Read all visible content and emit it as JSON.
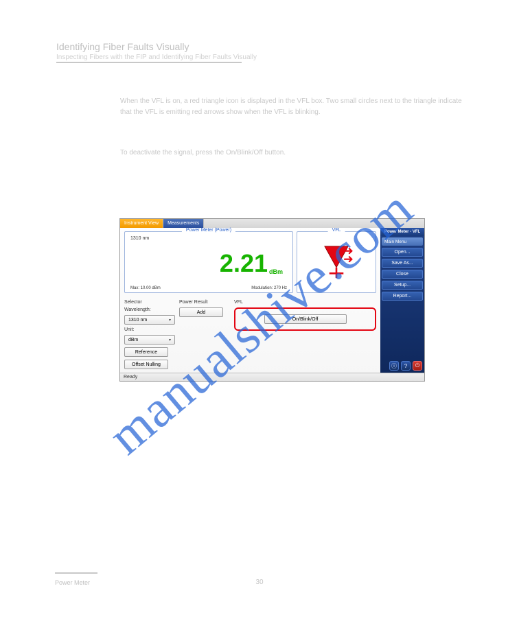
{
  "page": {
    "header_title": "Identifying Fiber Faults Visually",
    "header_subtitle": "Inspecting Fibers with the FIP and Identifying Fiber Faults Visually",
    "para1_line1": "When the VFL is on, a red triangle icon is displayed in the VFL box. Two small",
    "para1_line2": "circles next to the triangle indicate that the VFL is emitting red arrows show",
    "para1_line3": "when the VFL is blinking.",
    "para2": "To deactivate the signal, press the On/Blink/Off button.",
    "footer": "Power Meter",
    "pagenum": "30"
  },
  "app": {
    "tabs": {
      "instrument": "Instrument View",
      "measurements": "Measurements"
    },
    "title_bar": "Power Meter - VFL",
    "power_panel": {
      "title": "Power Meter (Power)",
      "wavelength": "1310 nm",
      "value": "2.21",
      "unit": "dBm",
      "max": "Max: 10.00 dBm",
      "modulation": "Modulation: 270 Hz"
    },
    "vfl_panel": {
      "title": "VFL"
    },
    "selector": {
      "header": "Selector",
      "wavelength_label": "Wavelength:",
      "wavelength_value": "1310 nm",
      "unit_label": "Unit:",
      "unit_value": "dBm",
      "reference_btn": "Reference",
      "offset_btn": "Offset Nulling"
    },
    "power_result": {
      "header": "Power Result",
      "add_btn": "Add"
    },
    "vfl_ctrl": {
      "header": "VFL",
      "btn": "On/Blink/Off"
    },
    "status": "Ready",
    "sidebar": {
      "main_menu": "Main Menu",
      "open": "Open...",
      "save_as": "Save As...",
      "close": "Close",
      "setup": "Setup...",
      "report": "Report..."
    }
  },
  "watermark": "manualshive.com"
}
